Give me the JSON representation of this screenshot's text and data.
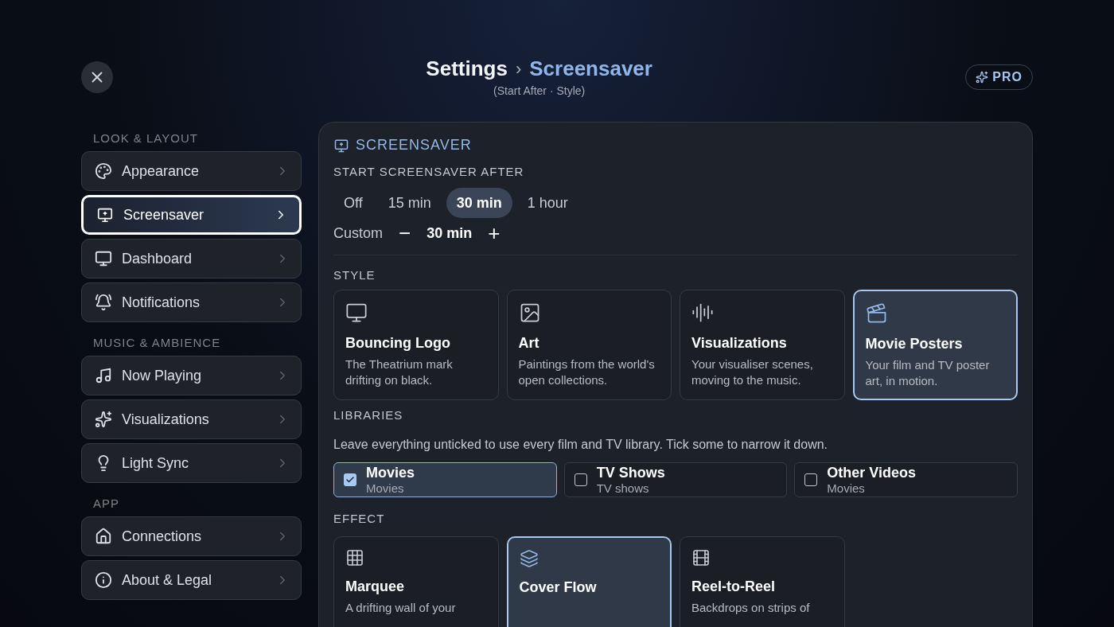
{
  "header": {
    "breadcrumb_root": "Settings",
    "breadcrumb_separator": "›",
    "breadcrumb_current": "Screensaver",
    "subtitle": "(Start After · Style)",
    "badge": "PRO"
  },
  "sidebar": {
    "sections": [
      {
        "title": "LOOK & LAYOUT",
        "items": [
          {
            "label": "Appearance",
            "selected": false
          },
          {
            "label": "Screensaver",
            "selected": true
          },
          {
            "label": "Dashboard",
            "selected": false
          },
          {
            "label": "Notifications",
            "selected": false
          }
        ]
      },
      {
        "title": "MUSIC & AMBIENCE",
        "items": [
          {
            "label": "Now Playing",
            "selected": false
          },
          {
            "label": "Visualizations",
            "selected": false
          },
          {
            "label": "Light Sync",
            "selected": false
          }
        ]
      },
      {
        "title": "APP",
        "items": [
          {
            "label": "Connections",
            "selected": false
          },
          {
            "label": "About & Legal",
            "selected": false
          }
        ]
      }
    ]
  },
  "panel": {
    "title": "SCREENSAVER",
    "start_after": {
      "label": "START SCREENSAVER AFTER",
      "options": [
        {
          "label": "Off",
          "selected": false
        },
        {
          "label": "15 min",
          "selected": false
        },
        {
          "label": "30 min",
          "selected": true
        },
        {
          "label": "1 hour",
          "selected": false
        }
      ],
      "custom": {
        "label": "Custom",
        "decrement": "−",
        "value": "30 min",
        "increment": "+"
      }
    },
    "style": {
      "label": "STYLE",
      "options": [
        {
          "title": "Bouncing Logo",
          "description": "The Theatrium mark drifting on black.",
          "selected": false
        },
        {
          "title": "Art",
          "description": "Paintings from the world's open collections.",
          "selected": false
        },
        {
          "title": "Visualizations",
          "description": "Your visualiser scenes, moving to the music.",
          "selected": false
        },
        {
          "title": "Movie Posters",
          "description": "Your film and TV poster art, in motion.",
          "selected": true
        }
      ]
    },
    "libraries": {
      "label": "LIBRARIES",
      "hint": "Leave everything unticked to use every film and TV library. Tick some to narrow it down.",
      "items": [
        {
          "name": "Movies",
          "type": "Movies",
          "checked": true
        },
        {
          "name": "TV Shows",
          "type": "TV shows",
          "checked": false
        },
        {
          "name": "Other Videos",
          "type": "Movies",
          "checked": false
        }
      ]
    },
    "effect": {
      "label": "EFFECT",
      "options": [
        {
          "title": "Marquee",
          "description": "A drifting wall of your",
          "selected": false
        },
        {
          "title": "Cover Flow",
          "selected": true
        },
        {
          "title": "Reel-to-Reel",
          "description": "Backdrops on strips of",
          "selected": false
        }
      ]
    }
  }
}
